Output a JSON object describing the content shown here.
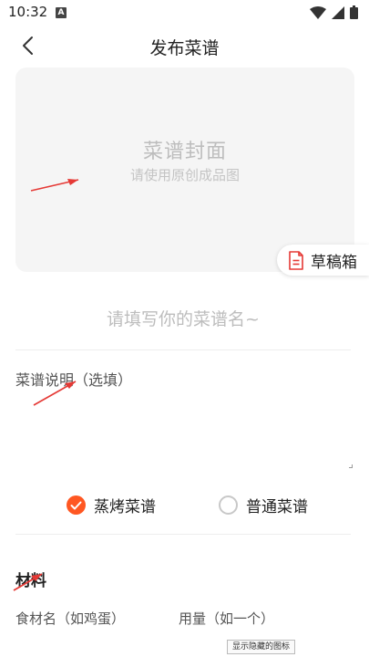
{
  "status_bar": {
    "time": "10:32",
    "notification_letter": "A"
  },
  "header": {
    "title": "发布菜谱"
  },
  "cover": {
    "title": "菜谱封面",
    "subtitle": "请使用原创成品图"
  },
  "draft_box": {
    "label": "草稿箱"
  },
  "recipe_name": {
    "placeholder": "请填写你的菜谱名~"
  },
  "description": {
    "placeholder": "菜谱说明（选填）"
  },
  "recipe_type": {
    "options": [
      {
        "label": "蒸烤菜谱",
        "selected": true
      },
      {
        "label": "普通菜谱",
        "selected": false
      }
    ]
  },
  "materials": {
    "title": "材料",
    "ingredient_placeholder": "食材名（如鸡蛋）",
    "amount_placeholder": "用量（如一个）"
  },
  "tooltip": {
    "text": "显示隐藏的图标"
  },
  "colors": {
    "accent": "#ff5722",
    "annotation_arrow": "#e53935",
    "cover_bg": "#f5f5f5"
  },
  "icons": [
    "back-arrow-icon",
    "wifi-icon",
    "signal-icon",
    "battery-icon",
    "document-icon",
    "check-icon"
  ]
}
